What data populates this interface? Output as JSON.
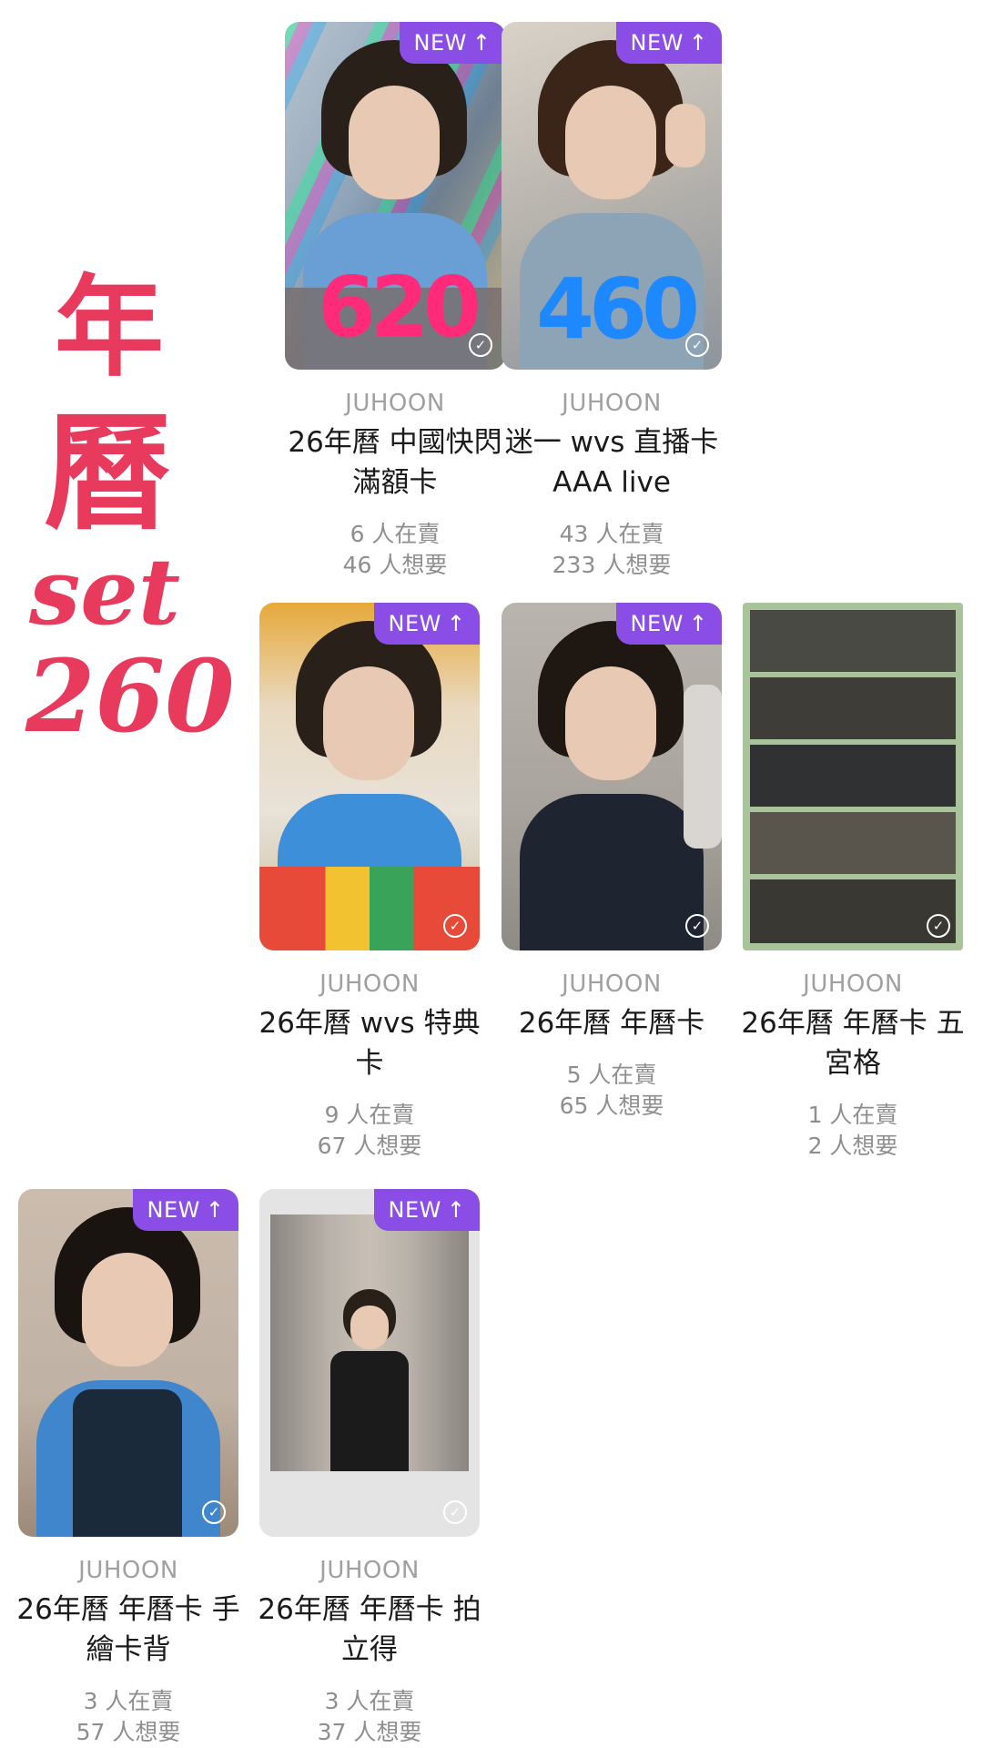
{
  "side_note": {
    "line1": "年",
    "line2": "曆",
    "line3": "set",
    "line4": "260"
  },
  "badge_label": "NEW",
  "badge_arrow_icon": "arrow-up-icon",
  "cards": [
    {
      "group": "JUHOON",
      "title": "26年曆 中國快閃 滿額卡",
      "sellers": "6 人在賣",
      "wanters": "46 人想要",
      "badge": true,
      "overlay_price": "620",
      "overlay_color": "#ff2a7a"
    },
    {
      "group": "JUHOON",
      "title": "迷一 wvs 直播卡 AAA live",
      "sellers": "43 人在賣",
      "wanters": "233 人想要",
      "badge": true,
      "overlay_price": "460",
      "overlay_color": "#1e88ff"
    },
    {
      "group": "JUHOON",
      "title": "26年曆 wvs 特典卡",
      "sellers": "9 人在賣",
      "wanters": "67 人想要",
      "badge": true
    },
    {
      "group": "JUHOON",
      "title": "26年曆 年曆卡",
      "sellers": "5 人在賣",
      "wanters": "65 人想要",
      "badge": true
    },
    {
      "group": "JUHOON",
      "title": "26年曆 年曆卡 五宮格",
      "sellers": "1 人在賣",
      "wanters": "2 人想要",
      "badge": false
    },
    {
      "group": "JUHOON",
      "title": "26年曆 年曆卡 手繪卡背",
      "sellers": "3 人在賣",
      "wanters": "57 人想要",
      "badge": true
    },
    {
      "group": "JUHOON",
      "title": "26年曆 年曆卡 拍立得",
      "sellers": "3 人在賣",
      "wanters": "37 人想要",
      "badge": true
    }
  ]
}
